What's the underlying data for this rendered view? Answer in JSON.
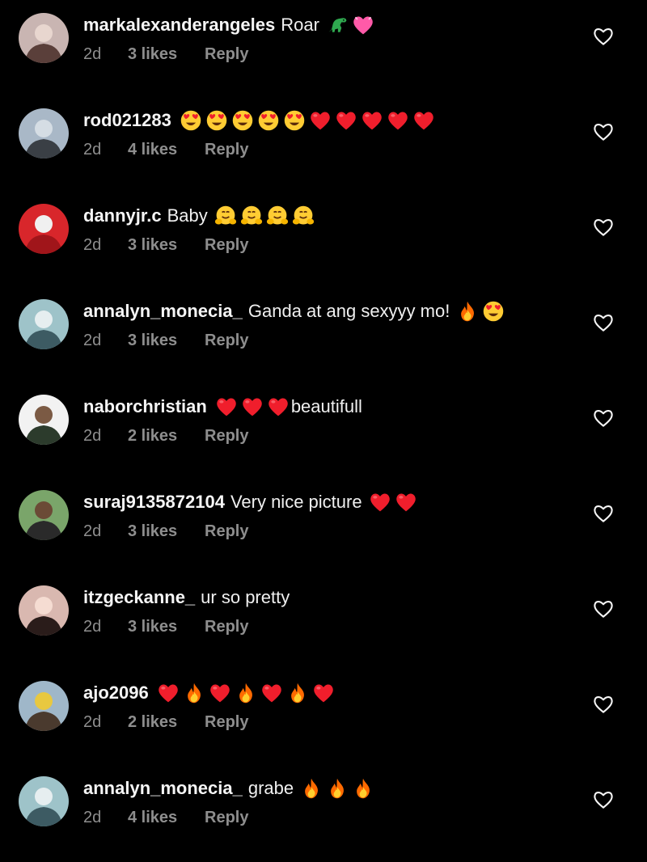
{
  "comments": [
    {
      "username": "markalexanderangeles",
      "text": "Roar",
      "emojis_after_text": [
        "dinosaur",
        "pink-heart"
      ],
      "age": "2d",
      "likes": "3 likes",
      "reply": "Reply",
      "avatar_colors": [
        "#c9b5b2",
        "#e8d6cf",
        "#5a3f3a"
      ]
    },
    {
      "username": "rod021283",
      "text": "",
      "emojis_after_text": [
        "heart-eyes",
        "heart-eyes",
        "heart-eyes",
        "heart-eyes",
        "heart-eyes",
        "red-heart",
        "red-heart",
        "red-heart",
        "red-heart",
        "red-heart"
      ],
      "age": "2d",
      "likes": "4 likes",
      "reply": "Reply",
      "avatar_colors": [
        "#a9b8c7",
        "#d5dde4",
        "#3a3f45"
      ]
    },
    {
      "username": "dannyjr.c",
      "text": "Baby",
      "emojis_after_text": [
        "hug",
        "hug",
        "hug",
        "hug"
      ],
      "age": "2d",
      "likes": "3 likes",
      "reply": "Reply",
      "avatar_colors": [
        "#d8262b",
        "#f0f0f0",
        "#a0151a"
      ]
    },
    {
      "username": "annalyn_monecia_",
      "text": "Ganda at ang sexyyy mo!",
      "emojis_after_text": [
        "fire",
        "heart-eyes"
      ],
      "age": "2d",
      "likes": "3 likes",
      "reply": "Reply",
      "avatar_colors": [
        "#9ec3c9",
        "#e6eef0",
        "#3d5b63"
      ]
    },
    {
      "username": "naborchristian",
      "text": "beautifull",
      "emojis_before_text": [
        "red-heart",
        "red-heart",
        "red-heart"
      ],
      "emojis_after_text": [],
      "age": "2d",
      "likes": "2 likes",
      "reply": "Reply",
      "avatar_colors": [
        "#f2f2f2",
        "#7b5a44",
        "#2c3b2c"
      ]
    },
    {
      "username": "suraj9135872104",
      "text": "Very nice picture",
      "emojis_after_text": [
        "red-heart",
        "red-heart"
      ],
      "age": "2d",
      "likes": "3 likes",
      "reply": "Reply",
      "avatar_colors": [
        "#7aa56a",
        "#6b4a36",
        "#2a2a2a"
      ]
    },
    {
      "username": "itzgeckanne_",
      "text": "ur so pretty",
      "emojis_after_text": [],
      "age": "2d",
      "likes": "3 likes",
      "reply": "Reply",
      "avatar_colors": [
        "#d9b8b0",
        "#f5dcd2",
        "#2a1c1a"
      ]
    },
    {
      "username": "ajo2096",
      "text": "",
      "emojis_after_text": [
        "red-heart",
        "fire",
        "red-heart",
        "fire",
        "red-heart",
        "fire",
        "red-heart"
      ],
      "age": "2d",
      "likes": "2 likes",
      "reply": "Reply",
      "avatar_colors": [
        "#9fb7c9",
        "#e8c840",
        "#4a3a2e"
      ]
    },
    {
      "username": "annalyn_monecia_",
      "text": "grabe",
      "emojis_after_text": [
        "fire",
        "fire",
        "fire"
      ],
      "age": "2d",
      "likes": "4 likes",
      "reply": "Reply",
      "avatar_colors": [
        "#9ec3c9",
        "#e6eef0",
        "#3d5b63"
      ]
    }
  ],
  "colors": {
    "background": "#000000",
    "primary_text": "#f5f5f5",
    "secondary_text": "#8e8e8e",
    "heart_red": "#f01e2c",
    "heart_icon_outline": "#f5f5f5"
  }
}
